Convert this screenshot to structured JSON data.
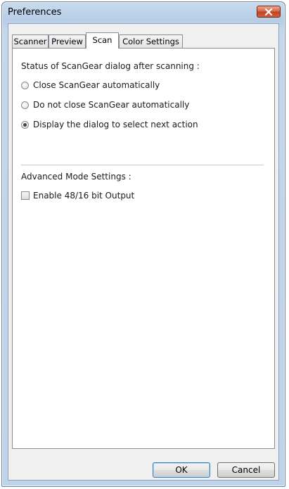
{
  "window": {
    "title": "Preferences"
  },
  "tabs": [
    {
      "label": "Scanner",
      "active": false
    },
    {
      "label": "Preview",
      "active": false
    },
    {
      "label": "Scan",
      "active": true
    },
    {
      "label": "Color Settings",
      "active": false
    }
  ],
  "scan": {
    "status_heading": "Status of ScanGear dialog after scanning :",
    "options": [
      {
        "label": "Close ScanGear automatically",
        "selected": false
      },
      {
        "label": "Do not close ScanGear automatically",
        "selected": false
      },
      {
        "label": "Display the dialog to select next action",
        "selected": true
      }
    ],
    "advanced_heading": "Advanced Mode Settings :",
    "enable_48_16": {
      "label": "Enable 48/16 bit Output",
      "checked": false
    }
  },
  "buttons": {
    "ok": "OK",
    "cancel": "Cancel"
  },
  "icons": {
    "close": "close-icon"
  },
  "colors": {
    "close_button": "#c2421f",
    "title_bar": "#b6cde6",
    "default_button_border": "#3c7fb1"
  }
}
